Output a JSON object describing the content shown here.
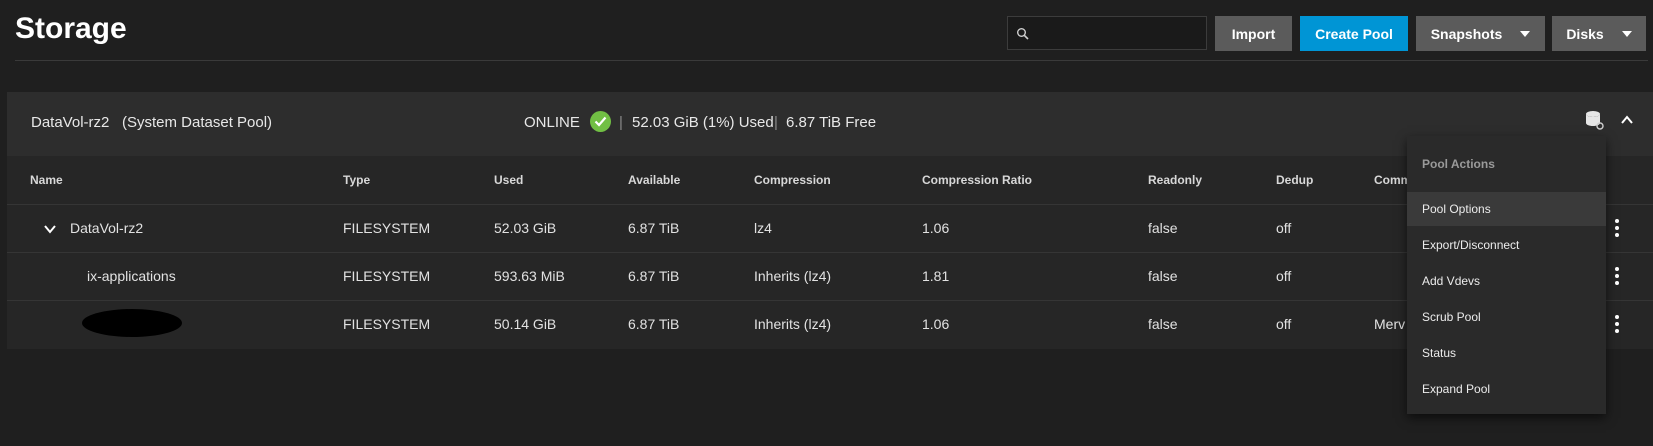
{
  "header": {
    "title": "Storage",
    "search": {
      "placeholder": "",
      "value": ""
    },
    "buttons": {
      "import": "Import",
      "create_pool": "Create Pool",
      "snapshots": "Snapshots",
      "disks": "Disks"
    }
  },
  "colors": {
    "accent": "#0095d5",
    "online": "#71bf44",
    "background": "#1f1f1f",
    "menu_bg": "#2a2a2a"
  },
  "pool": {
    "name": "DataVol-rz2",
    "subtitle": "(System Dataset Pool)",
    "status": "ONLINE",
    "separator": "|",
    "used": "52.03 GiB (1%) Used",
    "free": "6.87 TiB Free"
  },
  "table": {
    "columns": [
      "Name",
      "Type",
      "Used",
      "Available",
      "Compression",
      "Compression Ratio",
      "Readonly",
      "Dedup",
      "Comm"
    ],
    "rows": [
      {
        "name": "DataVol-rz2",
        "type": "FILESYSTEM",
        "used": "52.03 GiB",
        "available": "6.87 TiB",
        "compression": "lz4",
        "ratio": "1.06",
        "readonly": "false",
        "dedup": "off",
        "comments": ""
      },
      {
        "name": "ix-applications",
        "type": "FILESYSTEM",
        "used": "593.63 MiB",
        "available": "6.87 TiB",
        "compression": "Inherits (lz4)",
        "ratio": "1.81",
        "readonly": "false",
        "dedup": "off",
        "comments": ""
      },
      {
        "name": "",
        "type": "FILESYSTEM",
        "used": "50.14 GiB",
        "available": "6.87 TiB",
        "compression": "Inherits (lz4)",
        "ratio": "1.06",
        "readonly": "false",
        "dedup": "off",
        "comments": "Merv"
      }
    ]
  },
  "pool_actions_menu": {
    "title": "Pool Actions",
    "items": [
      "Pool Options",
      "Export/Disconnect",
      "Add Vdevs",
      "Scrub Pool",
      "Status",
      "Expand Pool"
    ],
    "highlighted": "Pool Options"
  },
  "icons": [
    "search-icon",
    "caret-down-icon",
    "check-circle-icon",
    "database-icon",
    "chevron-up-icon",
    "chevron-down-icon",
    "more-vert-icon"
  ]
}
